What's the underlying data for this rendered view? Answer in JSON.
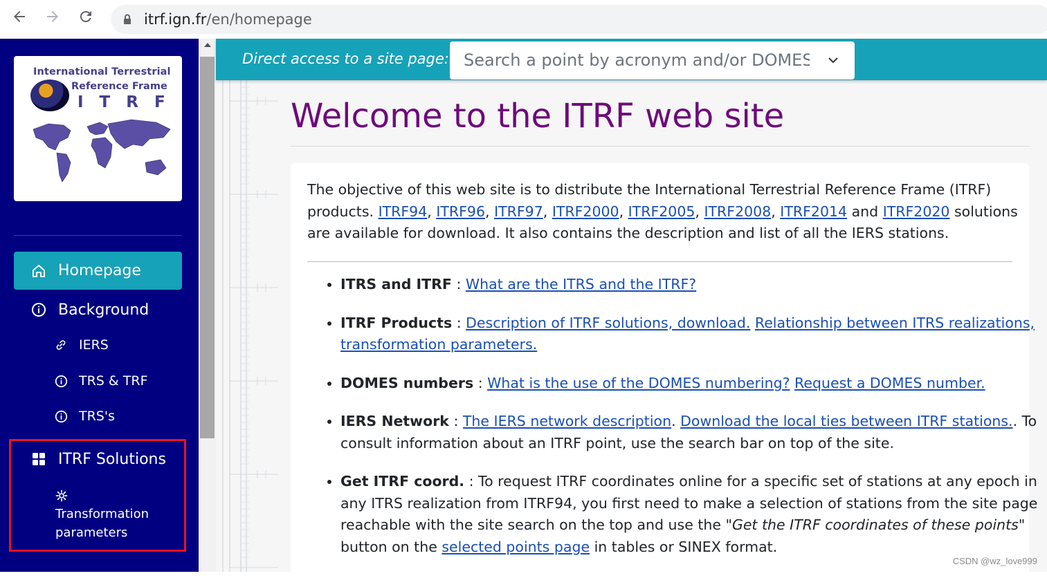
{
  "browser": {
    "url_host": "itrf.ign.fr",
    "url_path": "/en/homepage"
  },
  "logo": {
    "line1": "International Terrestrial",
    "line2": "Reference Frame",
    "line3": "ITRF"
  },
  "sidebar": {
    "items": [
      {
        "label": "Homepage",
        "icon": "home-icon"
      },
      {
        "label": "Background",
        "icon": "info-icon"
      },
      {
        "label": "IERS",
        "icon": "link-icon"
      },
      {
        "label": "TRS & TRF",
        "icon": "info-icon"
      },
      {
        "label": "TRS's",
        "icon": "info-icon"
      },
      {
        "label": "ITRF Solutions",
        "icon": "grid-icon"
      },
      {
        "label_1": "Transformation",
        "label_2": "parameters",
        "icon": "gear-icon"
      }
    ]
  },
  "topbar": {
    "direct_label": "Direct access to a site page:",
    "search_placeholder": "Search a point by acronym and/or DOMES"
  },
  "main": {
    "title": "Welcome to the ITRF web site",
    "intro": {
      "t1": "The objective of this web site is to distribute the International Terrestrial Reference Frame (ITRF) products. ",
      "links": [
        "ITRF94",
        "ITRF96",
        "ITRF97",
        "ITRF2000",
        "ITRF2005",
        "ITRF2008",
        "ITRF2014",
        "ITRF2020"
      ],
      "sep": ", ",
      "and": " and ",
      "t2": " solutions are available for download. It also contains the description and list of all the IERS stations."
    },
    "bullets": {
      "itrs": {
        "title": "ITRS and ITRF",
        "sep": " : ",
        "link1": "What are the ITRS and the ITRF?"
      },
      "products": {
        "title": "ITRF Products",
        "sep": " : ",
        "link1": "Description of ITRF solutions, download.",
        "link2": "Relationship between ITRS realizations, transformation parameters."
      },
      "domes": {
        "title": "DOMES numbers",
        "sep": " : ",
        "link1": "What is the use of the DOMES numbering?",
        "link2": "Request a DOMES number."
      },
      "iers": {
        "title": "IERS Network",
        "sep": " : ",
        "link1": "The IERS network description",
        "dot": ". ",
        "link2": "Download the local ties between ITRF stations.",
        "after": ". To consult information about an ITRF point, use the search bar on top of the site."
      },
      "coord": {
        "title": "Get ITRF coord.",
        "t1": " : To request ITRF coordinates online for a specific set of stations at any epoch in any ITRS realization from ITRF94, you first need to make a selection of stations from the site page reachable with the site search on the top and use the \"",
        "em": "Get the ITRF coordinates of these points",
        "t2": "\" button on the ",
        "link1": "selected points page",
        "t3": " in tables or SINEX format."
      }
    }
  },
  "watermark": "CSDN @wz_love999",
  "colors": {
    "sidebar_bg": "#010080",
    "accent": "#16a2b8",
    "title": "#6e0a7a",
    "link": "#1a4fb5",
    "highlight_box": "#e8141f"
  }
}
